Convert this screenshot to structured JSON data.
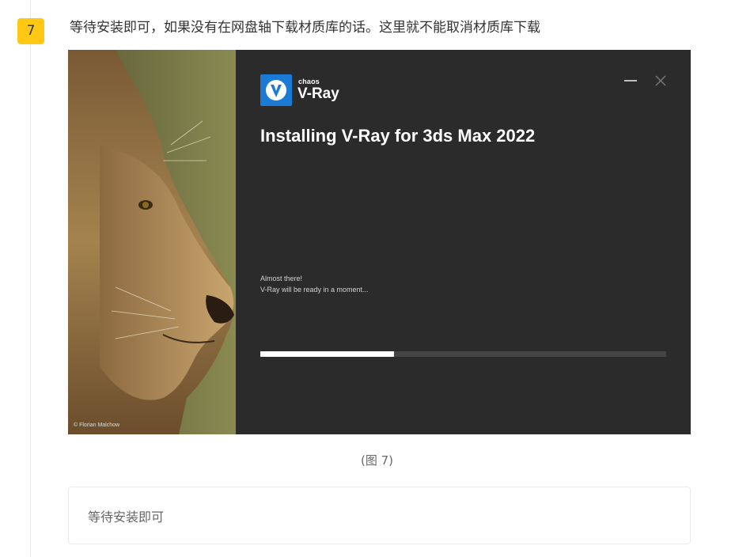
{
  "step": {
    "number": "7",
    "text": "等待安装即可，如果没有在网盘轴下载材质库的话。这里就不能取消材质库下载"
  },
  "installer": {
    "brand_small": "chaos",
    "brand_name": "V-Ray",
    "logo_icon": "v-ray-logo-icon",
    "title": "Installing V-Ray for 3ds Max 2022",
    "status_line_1": "Almost there!",
    "status_line_2": "V-Ray will be ready in a moment...",
    "progress": 0.33,
    "photo_credit": "© Florian Malchow",
    "colors": {
      "background": "#2b2b2b",
      "brand_blue": "#1a7bd7",
      "progress_fill": "#ffffff",
      "progress_track": "#444444"
    }
  },
  "caption": "(图 7)",
  "note": "等待安装即可",
  "colors": {
    "badge": "#ffc814"
  }
}
